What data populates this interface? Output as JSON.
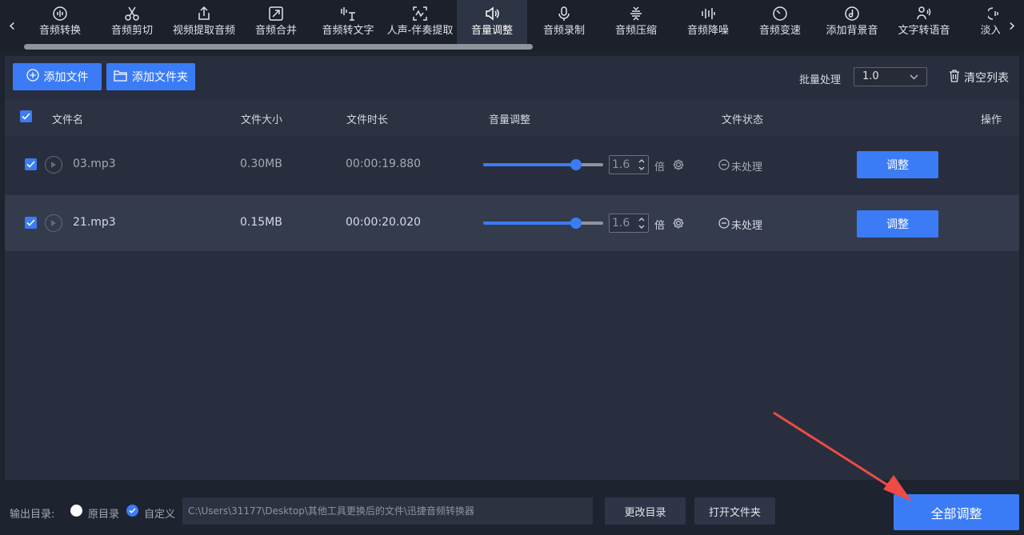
{
  "toolbar": {
    "nav_left": "‹",
    "nav_right": "›",
    "tools": [
      {
        "label": "音频转换",
        "icon": "audio-convert-icon"
      },
      {
        "label": "音频剪切",
        "icon": "scissors-icon"
      },
      {
        "label": "视频提取音频",
        "icon": "extract-upload-icon"
      },
      {
        "label": "音频合并",
        "icon": "merge-icon"
      },
      {
        "label": "音频转文字",
        "icon": "speech-to-text-icon"
      },
      {
        "label": "人声-伴奏提取",
        "icon": "vocal-separate-icon"
      },
      {
        "label": "音量调整",
        "icon": "volume-icon",
        "active": true
      },
      {
        "label": "音频录制",
        "icon": "microphone-icon"
      },
      {
        "label": "音频压缩",
        "icon": "compress-icon"
      },
      {
        "label": "音频降噪",
        "icon": "noise-reduce-icon"
      },
      {
        "label": "音频变速",
        "icon": "speed-icon"
      },
      {
        "label": "添加背景音",
        "icon": "background-music-icon"
      },
      {
        "label": "文字转语音",
        "icon": "text-to-speech-icon"
      },
      {
        "label": "淡入淡",
        "icon": "fade-icon"
      }
    ]
  },
  "actions": {
    "add_file": "添加文件",
    "add_folder": "添加文件夹",
    "batch_label": "批量处理",
    "batch_value": "1.0",
    "clear_list": "清空列表"
  },
  "table": {
    "columns": [
      "文件名",
      "文件大小",
      "文件时长",
      "音量调整",
      "文件状态",
      "操作"
    ],
    "rows": [
      {
        "name": "03.mp3",
        "size": "0.30MB",
        "duration": "00:00:19.880",
        "volume": "1.6",
        "volume_level": 0.77,
        "unit": "倍",
        "status": "未处理",
        "action": "调整",
        "checked": true
      },
      {
        "name": "21.mp3",
        "size": "0.15MB",
        "duration": "00:00:20.020",
        "volume": "1.6",
        "volume_level": 0.77,
        "unit": "倍",
        "status": "未处理",
        "action": "调整",
        "checked": true
      }
    ]
  },
  "footer": {
    "output_label": "输出目录:",
    "radio_original": "原目录",
    "radio_custom": "自定义",
    "output_path": "C:\\Users\\31177\\Desktop\\其他工具更换后的文件\\迅捷音频转换器",
    "change_dir": "更改目录",
    "open_folder": "打开文件夹",
    "adjust_all": "全部调整"
  },
  "colors": {
    "accent": "#3b7cf6",
    "annotation": "#ee4b45"
  }
}
